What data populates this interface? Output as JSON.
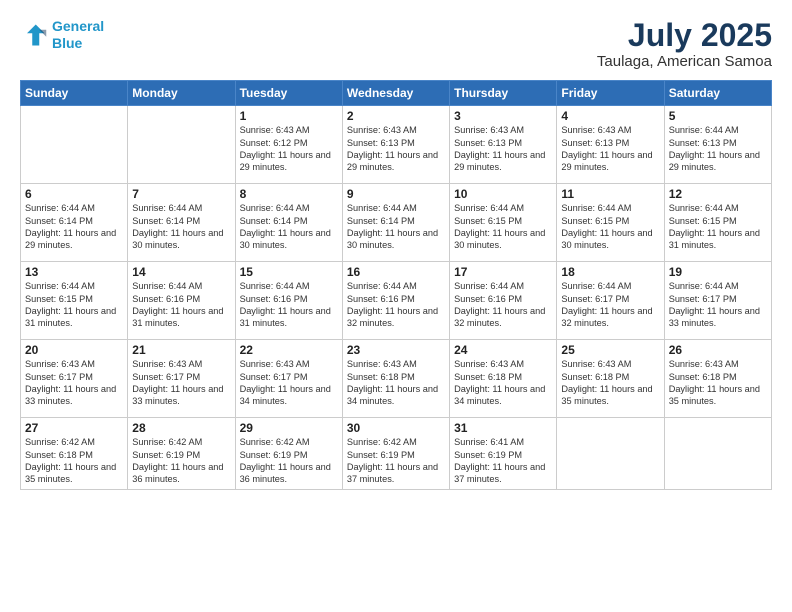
{
  "logo": {
    "line1": "General",
    "line2": "Blue"
  },
  "title": "July 2025",
  "subtitle": "Taulaga, American Samoa",
  "weekdays": [
    "Sunday",
    "Monday",
    "Tuesday",
    "Wednesday",
    "Thursday",
    "Friday",
    "Saturday"
  ],
  "weeks": [
    [
      {
        "day": "",
        "info": ""
      },
      {
        "day": "",
        "info": ""
      },
      {
        "day": "1",
        "info": "Sunrise: 6:43 AM\nSunset: 6:12 PM\nDaylight: 11 hours and 29 minutes."
      },
      {
        "day": "2",
        "info": "Sunrise: 6:43 AM\nSunset: 6:13 PM\nDaylight: 11 hours and 29 minutes."
      },
      {
        "day": "3",
        "info": "Sunrise: 6:43 AM\nSunset: 6:13 PM\nDaylight: 11 hours and 29 minutes."
      },
      {
        "day": "4",
        "info": "Sunrise: 6:43 AM\nSunset: 6:13 PM\nDaylight: 11 hours and 29 minutes."
      },
      {
        "day": "5",
        "info": "Sunrise: 6:44 AM\nSunset: 6:13 PM\nDaylight: 11 hours and 29 minutes."
      }
    ],
    [
      {
        "day": "6",
        "info": "Sunrise: 6:44 AM\nSunset: 6:14 PM\nDaylight: 11 hours and 29 minutes."
      },
      {
        "day": "7",
        "info": "Sunrise: 6:44 AM\nSunset: 6:14 PM\nDaylight: 11 hours and 30 minutes."
      },
      {
        "day": "8",
        "info": "Sunrise: 6:44 AM\nSunset: 6:14 PM\nDaylight: 11 hours and 30 minutes."
      },
      {
        "day": "9",
        "info": "Sunrise: 6:44 AM\nSunset: 6:14 PM\nDaylight: 11 hours and 30 minutes."
      },
      {
        "day": "10",
        "info": "Sunrise: 6:44 AM\nSunset: 6:15 PM\nDaylight: 11 hours and 30 minutes."
      },
      {
        "day": "11",
        "info": "Sunrise: 6:44 AM\nSunset: 6:15 PM\nDaylight: 11 hours and 30 minutes."
      },
      {
        "day": "12",
        "info": "Sunrise: 6:44 AM\nSunset: 6:15 PM\nDaylight: 11 hours and 31 minutes."
      }
    ],
    [
      {
        "day": "13",
        "info": "Sunrise: 6:44 AM\nSunset: 6:15 PM\nDaylight: 11 hours and 31 minutes."
      },
      {
        "day": "14",
        "info": "Sunrise: 6:44 AM\nSunset: 6:16 PM\nDaylight: 11 hours and 31 minutes."
      },
      {
        "day": "15",
        "info": "Sunrise: 6:44 AM\nSunset: 6:16 PM\nDaylight: 11 hours and 31 minutes."
      },
      {
        "day": "16",
        "info": "Sunrise: 6:44 AM\nSunset: 6:16 PM\nDaylight: 11 hours and 32 minutes."
      },
      {
        "day": "17",
        "info": "Sunrise: 6:44 AM\nSunset: 6:16 PM\nDaylight: 11 hours and 32 minutes."
      },
      {
        "day": "18",
        "info": "Sunrise: 6:44 AM\nSunset: 6:17 PM\nDaylight: 11 hours and 32 minutes."
      },
      {
        "day": "19",
        "info": "Sunrise: 6:44 AM\nSunset: 6:17 PM\nDaylight: 11 hours and 33 minutes."
      }
    ],
    [
      {
        "day": "20",
        "info": "Sunrise: 6:43 AM\nSunset: 6:17 PM\nDaylight: 11 hours and 33 minutes."
      },
      {
        "day": "21",
        "info": "Sunrise: 6:43 AM\nSunset: 6:17 PM\nDaylight: 11 hours and 33 minutes."
      },
      {
        "day": "22",
        "info": "Sunrise: 6:43 AM\nSunset: 6:17 PM\nDaylight: 11 hours and 34 minutes."
      },
      {
        "day": "23",
        "info": "Sunrise: 6:43 AM\nSunset: 6:18 PM\nDaylight: 11 hours and 34 minutes."
      },
      {
        "day": "24",
        "info": "Sunrise: 6:43 AM\nSunset: 6:18 PM\nDaylight: 11 hours and 34 minutes."
      },
      {
        "day": "25",
        "info": "Sunrise: 6:43 AM\nSunset: 6:18 PM\nDaylight: 11 hours and 35 minutes."
      },
      {
        "day": "26",
        "info": "Sunrise: 6:43 AM\nSunset: 6:18 PM\nDaylight: 11 hours and 35 minutes."
      }
    ],
    [
      {
        "day": "27",
        "info": "Sunrise: 6:42 AM\nSunset: 6:18 PM\nDaylight: 11 hours and 35 minutes."
      },
      {
        "day": "28",
        "info": "Sunrise: 6:42 AM\nSunset: 6:19 PM\nDaylight: 11 hours and 36 minutes."
      },
      {
        "day": "29",
        "info": "Sunrise: 6:42 AM\nSunset: 6:19 PM\nDaylight: 11 hours and 36 minutes."
      },
      {
        "day": "30",
        "info": "Sunrise: 6:42 AM\nSunset: 6:19 PM\nDaylight: 11 hours and 37 minutes."
      },
      {
        "day": "31",
        "info": "Sunrise: 6:41 AM\nSunset: 6:19 PM\nDaylight: 11 hours and 37 minutes."
      },
      {
        "day": "",
        "info": ""
      },
      {
        "day": "",
        "info": ""
      }
    ]
  ]
}
